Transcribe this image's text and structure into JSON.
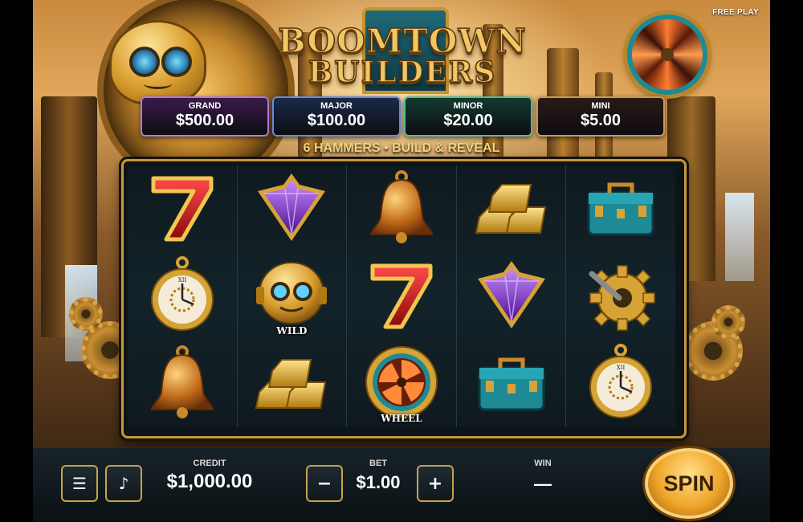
{
  "game": {
    "title_line1": "BOOMTOWN",
    "title_line2": "BUILDERS",
    "mode_badge": "FREE PLAY",
    "feature_text": "6 HAMMERS • BUILD & REVEAL"
  },
  "jackpots": [
    {
      "name": "GRAND",
      "value": "$500.00",
      "color": "#3a1a4a",
      "border": "#b07ad8"
    },
    {
      "name": "MAJOR",
      "value": "$100.00",
      "color": "#1a2a4a",
      "border": "#6a8ad8"
    },
    {
      "name": "MINOR",
      "value": "$20.00",
      "color": "#123a2e",
      "border": "#5ab89a"
    },
    {
      "name": "MINI",
      "value": "$5.00",
      "color": "#2a1a14",
      "border": "#c59a5a"
    }
  ],
  "reels": [
    [
      "seven",
      "diamond",
      "bell",
      "gold-bars",
      "toolbox"
    ],
    [
      "pocket-watch",
      "robot-wild",
      "seven",
      "diamond",
      "gear-wrench"
    ],
    [
      "bell",
      "gold-bars",
      "porthole-wheel",
      "toolbox",
      "pocket-watch"
    ]
  ],
  "symbol_labels": {
    "robot-wild": "WILD",
    "porthole-wheel": "WHEEL"
  },
  "controls": {
    "menu_icon": "menu-icon",
    "sound_icon": "music-note-icon",
    "credit_label": "CREDIT",
    "credit_value": "$1,000.00",
    "bet_label": "BET",
    "bet_value": "$1.00",
    "bet_minus": "−",
    "bet_plus": "+",
    "win_label": "WIN",
    "win_value": "—",
    "spin_label": "SPIN",
    "menu_glyph": "☰",
    "sound_glyph": "♪"
  }
}
